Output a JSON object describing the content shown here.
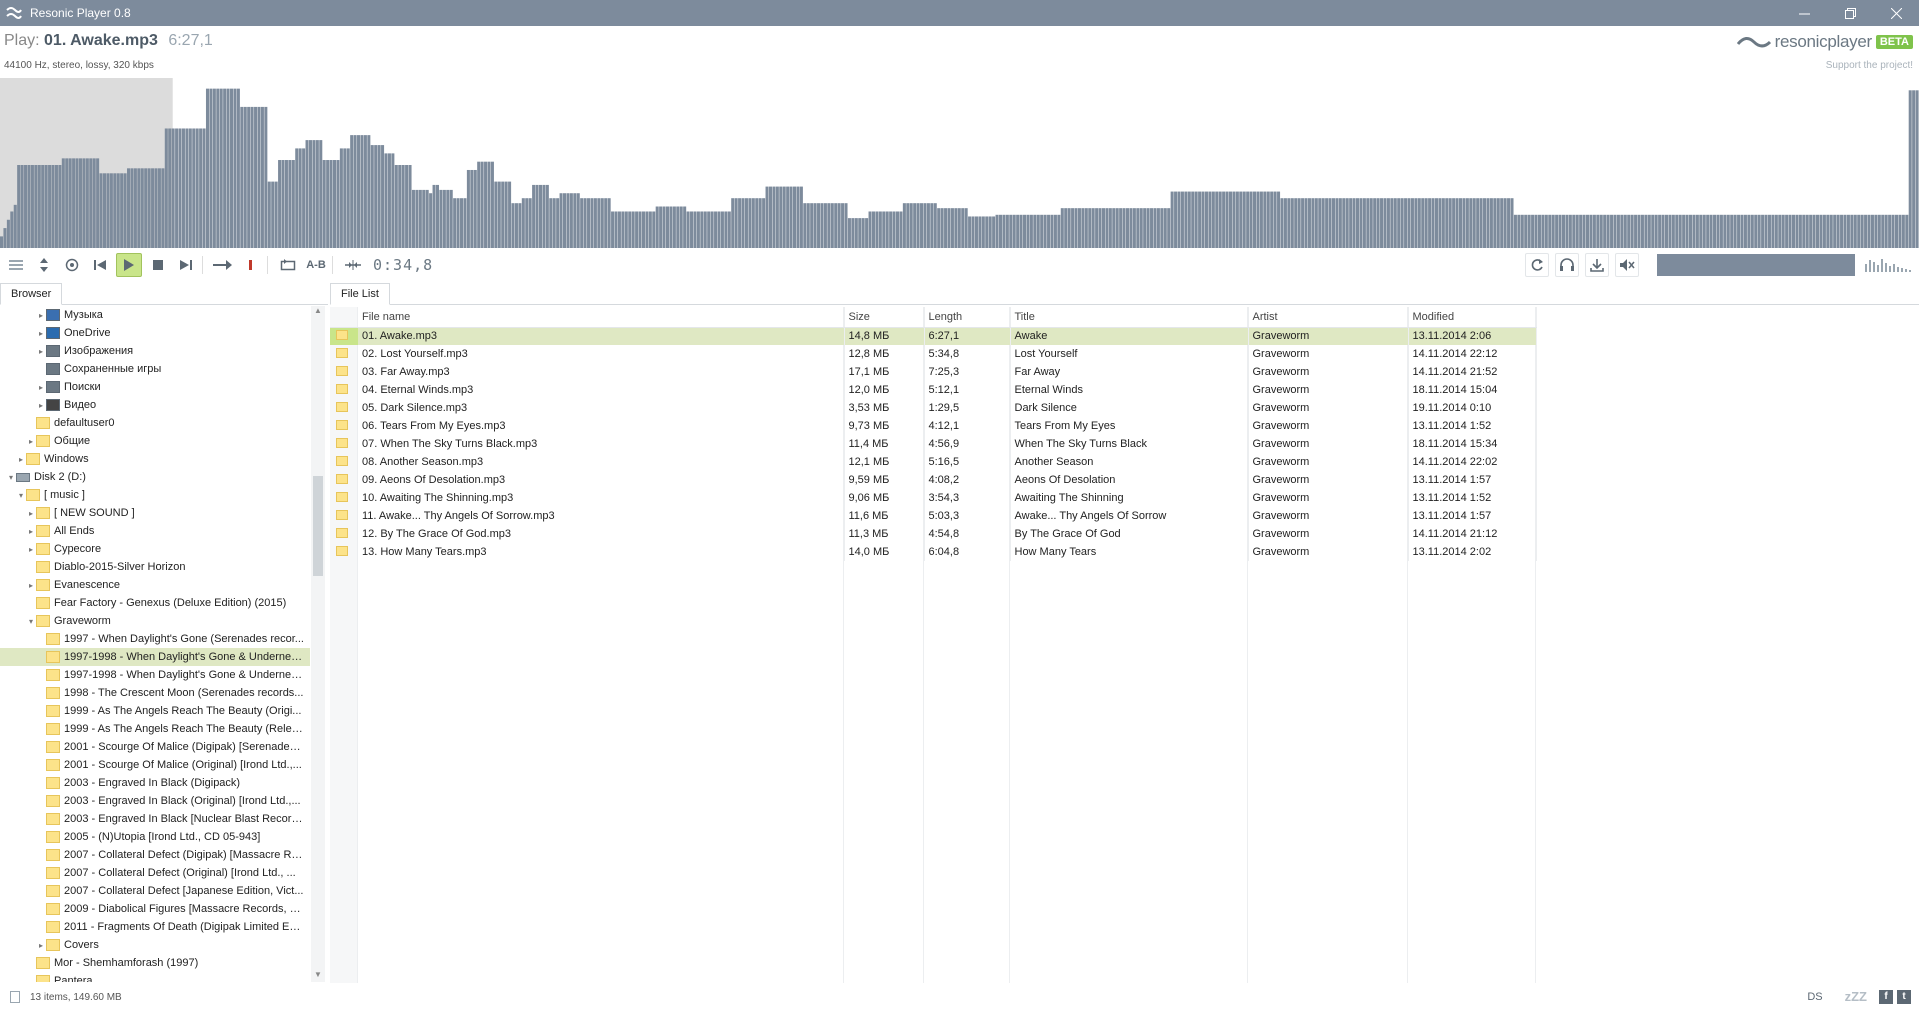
{
  "window": {
    "title": "Resonic Player 0.8",
    "controls": [
      "minimize",
      "restore",
      "close"
    ]
  },
  "nowplaying": {
    "prefix": "Play:",
    "track": "01. Awake.mp3",
    "duration": "6:27,1",
    "format": "44100 Hz, stereo, lossy, 320 kbps"
  },
  "brand": {
    "name": "resonicplayer",
    "badge": "BETA",
    "support": "Support the project!"
  },
  "colors": {
    "accent": "#c9e58a",
    "selection": "#dfe8c3",
    "chrome": "#7d8b9c",
    "folder": "#fce38a"
  },
  "waveform": {
    "played_fraction": 0.09,
    "levels": [
      0.07,
      0.12,
      0.17,
      0.22,
      0.26,
      0.5,
      0.5,
      0.5,
      0.5,
      0.5,
      0.5,
      0.5,
      0.5,
      0.5,
      0.5,
      0.5,
      0.5,
      0.5,
      0.54,
      0.54,
      0.54,
      0.54,
      0.54,
      0.54,
      0.54,
      0.54,
      0.54,
      0.54,
      0.54,
      0.45,
      0.45,
      0.45,
      0.45,
      0.45,
      0.45,
      0.45,
      0.45,
      0.48,
      0.48,
      0.48,
      0.48,
      0.48,
      0.48,
      0.48,
      0.48,
      0.48,
      0.48,
      0.48,
      0.72,
      0.72,
      0.72,
      0.72,
      0.72,
      0.72,
      0.72,
      0.72,
      0.72,
      0.72,
      0.72,
      0.72,
      0.96,
      0.96,
      0.96,
      0.96,
      0.96,
      0.96,
      0.96,
      0.96,
      0.96,
      0.96,
      0.85,
      0.85,
      0.85,
      0.85,
      0.85,
      0.85,
      0.85,
      0.85,
      0.4,
      0.4,
      0.4,
      0.53,
      0.53,
      0.53,
      0.53,
      0.53,
      0.6,
      0.6,
      0.6,
      0.65,
      0.65,
      0.65,
      0.65,
      0.65,
      0.53,
      0.53,
      0.53,
      0.53,
      0.53,
      0.6,
      0.6,
      0.6,
      0.68,
      0.68,
      0.68,
      0.68,
      0.68,
      0.68,
      0.62,
      0.62,
      0.62,
      0.62,
      0.57,
      0.57,
      0.57,
      0.5,
      0.5,
      0.5,
      0.5,
      0.5,
      0.35,
      0.35,
      0.35,
      0.35,
      0.35,
      0.33,
      0.38,
      0.38,
      0.35,
      0.35,
      0.35,
      0.35,
      0.3,
      0.3,
      0.3,
      0.3,
      0.47,
      0.47,
      0.47,
      0.52,
      0.52,
      0.52,
      0.52,
      0.52,
      0.4,
      0.4,
      0.4,
      0.4,
      0.4,
      0.27,
      0.27,
      0.27,
      0.3,
      0.3,
      0.3,
      0.38,
      0.38,
      0.38,
      0.38,
      0.38,
      0.3,
      0.3,
      0.3,
      0.33,
      0.33,
      0.33,
      0.33,
      0.33,
      0.33,
      0.3,
      0.3,
      0.3,
      0.3,
      0.3,
      0.3,
      0.3,
      0.3,
      0.3,
      0.22,
      0.22,
      0.22,
      0.22,
      0.22,
      0.22,
      0.22,
      0.22,
      0.22,
      0.22,
      0.22,
      0.22,
      0.22,
      0.25,
      0.25,
      0.25,
      0.25,
      0.25,
      0.25,
      0.25,
      0.25,
      0.25,
      0.22,
      0.22,
      0.22,
      0.22,
      0.22,
      0.22,
      0.22,
      0.22,
      0.22,
      0.22,
      0.22,
      0.22,
      0.22,
      0.3,
      0.3,
      0.3,
      0.3,
      0.3,
      0.3,
      0.3,
      0.3,
      0.3,
      0.3,
      0.37,
      0.37,
      0.37,
      0.37,
      0.37,
      0.37,
      0.37,
      0.37,
      0.37,
      0.37,
      0.37,
      0.27,
      0.27,
      0.27,
      0.27,
      0.27,
      0.27,
      0.27,
      0.27,
      0.27,
      0.27,
      0.27,
      0.27,
      0.27,
      0.18,
      0.18,
      0.18,
      0.18,
      0.18,
      0.18,
      0.22,
      0.22,
      0.22,
      0.22,
      0.22,
      0.22,
      0.22,
      0.22,
      0.22,
      0.22,
      0.27,
      0.27,
      0.27,
      0.27,
      0.27,
      0.27,
      0.27,
      0.27,
      0.27,
      0.27,
      0.24,
      0.24,
      0.24,
      0.24,
      0.24,
      0.24,
      0.24,
      0.24,
      0.24,
      0.19,
      0.19,
      0.19,
      0.19,
      0.19,
      0.19,
      0.19,
      0.19,
      0.2,
      0.2,
      0.2,
      0.2,
      0.2,
      0.2,
      0.2,
      0.2,
      0.2,
      0.2,
      0.2,
      0.2,
      0.2,
      0.2,
      0.2,
      0.2,
      0.2,
      0.2,
      0.2,
      0.24,
      0.24,
      0.24,
      0.24,
      0.24,
      0.24,
      0.24,
      0.24,
      0.24,
      0.24,
      0.24,
      0.24,
      0.24,
      0.24,
      0.24,
      0.24,
      0.24,
      0.24,
      0.24,
      0.24,
      0.24,
      0.24,
      0.24,
      0.24,
      0.24,
      0.24,
      0.24,
      0.24,
      0.24,
      0.24,
      0.24,
      0.24,
      0.34,
      0.34,
      0.34,
      0.34,
      0.34,
      0.34,
      0.34,
      0.34,
      0.34,
      0.34,
      0.34,
      0.34,
      0.34,
      0.34,
      0.34,
      0.34,
      0.34,
      0.34,
      0.34,
      0.34,
      0.34,
      0.34,
      0.34,
      0.34,
      0.34,
      0.34,
      0.34,
      0.34,
      0.34,
      0.34,
      0.34,
      0.34,
      0.3,
      0.3,
      0.3,
      0.3,
      0.3,
      0.3,
      0.3,
      0.3,
      0.3,
      0.3,
      0.3,
      0.3,
      0.3,
      0.3,
      0.3,
      0.3,
      0.3,
      0.3,
      0.3,
      0.3,
      0.3,
      0.3,
      0.3,
      0.3,
      0.3,
      0.3,
      0.3,
      0.3,
      0.3,
      0.3,
      0.3,
      0.3,
      0.3,
      0.3,
      0.3,
      0.3,
      0.3,
      0.3,
      0.3,
      0.3,
      0.3,
      0.3,
      0.3,
      0.3,
      0.3,
      0.3,
      0.3,
      0.3,
      0.3,
      0.3,
      0.3,
      0.3,
      0.3,
      0.3,
      0.3,
      0.3,
      0.3,
      0.3,
      0.3,
      0.3,
      0.3,
      0.3,
      0.3,
      0.3,
      0.3,
      0.3,
      0.3,
      0.3,
      0.2,
      0.2,
      0.2,
      0.2,
      0.2,
      0.2,
      0.2,
      0.2,
      0.2,
      0.2,
      0.2,
      0.2,
      0.2,
      0.2,
      0.2,
      0.2,
      0.2,
      0.2,
      0.2,
      0.2,
      0.2,
      0.2,
      0.2,
      0.2,
      0.2,
      0.2,
      0.2,
      0.2,
      0.2,
      0.2,
      0.2,
      0.2,
      0.2,
      0.2,
      0.2,
      0.2,
      0.2,
      0.2,
      0.2,
      0.2,
      0.2,
      0.2,
      0.2,
      0.2,
      0.2,
      0.2,
      0.2,
      0.2,
      0.2,
      0.2,
      0.2,
      0.2,
      0.2,
      0.2,
      0.2,
      0.2,
      0.2,
      0.2,
      0.2,
      0.2,
      0.2,
      0.2,
      0.2,
      0.2,
      0.2,
      0.2,
      0.2,
      0.2,
      0.2,
      0.2,
      0.2,
      0.2,
      0.2,
      0.2,
      0.2,
      0.2,
      0.2,
      0.2,
      0.2,
      0.2,
      0.2,
      0.2,
      0.2,
      0.2,
      0.2,
      0.2,
      0.2,
      0.2,
      0.2,
      0.2,
      0.2,
      0.2,
      0.2,
      0.2,
      0.2,
      0.2,
      0.2,
      0.2,
      0.2,
      0.2,
      0.2,
      0.2,
      0.2,
      0.2,
      0.2,
      0.2,
      0.2,
      0.2,
      0.2,
      0.2,
      0.2,
      0.2,
      0.2,
      0.2,
      0.2,
      0.95,
      0.95,
      0.95
    ]
  },
  "toolbar": {
    "position": "0:34,8",
    "left_buttons": [
      "list-icon",
      "updown-icon",
      "target-icon",
      "prev-icon",
      "play-icon",
      "stop-icon",
      "next-icon",
      "forward-icon",
      "record-icon",
      "loop-icon",
      "ab-icon",
      "split-icon"
    ],
    "ab_label": "A-B",
    "right_buttons": [
      "refresh-icon",
      "headphones-icon",
      "download-icon",
      "mute-icon"
    ]
  },
  "browser": {
    "tab": "Browser",
    "items": [
      {
        "label": "Музыка",
        "depth": 3,
        "exp": "▸",
        "icon": "music"
      },
      {
        "label": "OneDrive",
        "depth": 3,
        "exp": "▸",
        "icon": "cloud"
      },
      {
        "label": "Изображения",
        "depth": 3,
        "exp": "▸",
        "icon": "pictures"
      },
      {
        "label": "Сохраненные игры",
        "depth": 3,
        "exp": "",
        "icon": "games"
      },
      {
        "label": "Поиски",
        "depth": 3,
        "exp": "▸",
        "icon": "search"
      },
      {
        "label": "Видео",
        "depth": 3,
        "exp": "▸",
        "icon": "video"
      },
      {
        "label": "defaultuser0",
        "depth": 2,
        "exp": "",
        "icon": "folder"
      },
      {
        "label": "Общие",
        "depth": 2,
        "exp": "▸",
        "icon": "folder"
      },
      {
        "label": "Windows",
        "depth": 1,
        "exp": "▸",
        "icon": "folder"
      },
      {
        "label": "Disk 2 (D:)",
        "depth": 0,
        "exp": "▾",
        "icon": "drive"
      },
      {
        "label": "[ music ]",
        "depth": 1,
        "exp": "▾",
        "icon": "folder"
      },
      {
        "label": "[ NEW SOUND ]",
        "depth": 2,
        "exp": "▸",
        "icon": "folder"
      },
      {
        "label": "All Ends",
        "depth": 2,
        "exp": "▸",
        "icon": "folder"
      },
      {
        "label": "Cypecore",
        "depth": 2,
        "exp": "▸",
        "icon": "folder"
      },
      {
        "label": "Diablo-2015-Silver Horizon",
        "depth": 2,
        "exp": "",
        "icon": "folder"
      },
      {
        "label": "Evanescence",
        "depth": 2,
        "exp": "▸",
        "icon": "folder"
      },
      {
        "label": "Fear Factory - Genexus (Deluxe Edition) (2015)",
        "depth": 2,
        "exp": "",
        "icon": "folder"
      },
      {
        "label": "Graveworm",
        "depth": 2,
        "exp": "▾",
        "icon": "folder"
      },
      {
        "label": "1997 - When Daylight's Gone (Serenades recor...",
        "depth": 3,
        "exp": "",
        "icon": "folder"
      },
      {
        "label": "1997-1998 - When Daylight's Gone & Undernea...",
        "depth": 3,
        "exp": "",
        "icon": "folder",
        "selected": true
      },
      {
        "label": "1997-1998 - When Daylight's Gone & Underne a...",
        "depth": 3,
        "exp": "",
        "icon": "folder"
      },
      {
        "label": "1998 - The Crescent Moon (Serenades records...",
        "depth": 3,
        "exp": "",
        "icon": "folder"
      },
      {
        "label": "1999 - As The Angels Reach The Beauty (Origi...",
        "depth": 3,
        "exp": "",
        "icon": "folder"
      },
      {
        "label": "1999 - As The Angels Reach The Beauty (Relea...",
        "depth": 3,
        "exp": "",
        "icon": "folder"
      },
      {
        "label": "2001 - Scourge Of Malice (Digipak) [Serenades ...",
        "depth": 3,
        "exp": "",
        "icon": "folder"
      },
      {
        "label": "2001 - Scourge Of Malice (Original) [Irond Ltd.,...",
        "depth": 3,
        "exp": "",
        "icon": "folder"
      },
      {
        "label": "2003 - Engraved In Black (Digipack)",
        "depth": 3,
        "exp": "",
        "icon": "folder"
      },
      {
        "label": "2003 - Engraved In Black (Original) [Irond Ltd.,...",
        "depth": 3,
        "exp": "",
        "icon": "folder"
      },
      {
        "label": "2003 - Engraved In Black [Nuclear Blast Record...",
        "depth": 3,
        "exp": "",
        "icon": "folder"
      },
      {
        "label": "2005 - (N)Utopia [Irond Ltd., CD 05-943]",
        "depth": 3,
        "exp": "",
        "icon": "folder"
      },
      {
        "label": "2007 - Collateral Defect (Digipak) [Massacre Re...",
        "depth": 3,
        "exp": "",
        "icon": "folder"
      },
      {
        "label": "2007 - Collateral Defect (Original) [Irond Ltd., ...",
        "depth": 3,
        "exp": "",
        "icon": "folder"
      },
      {
        "label": "2007 - Collateral Defect [Japanese Edition, Vict...",
        "depth": 3,
        "exp": "",
        "icon": "folder"
      },
      {
        "label": "2009 - Diabolical Figures [Massacre Records, M...",
        "depth": 3,
        "exp": "",
        "icon": "folder"
      },
      {
        "label": "2011 - Fragments Of Death (Digipak Limited Edi...",
        "depth": 3,
        "exp": "",
        "icon": "folder"
      },
      {
        "label": "Covers",
        "depth": 3,
        "exp": "▸",
        "icon": "folder"
      },
      {
        "label": "Mor - Shemhamforash (1997)",
        "depth": 2,
        "exp": "",
        "icon": "folder"
      },
      {
        "label": "Pantera",
        "depth": 2,
        "exp": "",
        "icon": "folder"
      }
    ]
  },
  "filelist": {
    "tab": "File List",
    "columns": [
      "File name",
      "Size",
      "Length",
      "Title",
      "Artist",
      "Modified"
    ],
    "rows": [
      [
        "01. Awake.mp3",
        "14,8 МБ",
        "6:27,1",
        "Awake",
        "Graveworm",
        "13.11.2014 2:06"
      ],
      [
        "02. Lost Yourself.mp3",
        "12,8 МБ",
        "5:34,8",
        "Lost Yourself",
        "Graveworm",
        "14.11.2014 22:12"
      ],
      [
        "03. Far Away.mp3",
        "17,1 МБ",
        "7:25,3",
        "Far Away",
        "Graveworm",
        "14.11.2014 21:52"
      ],
      [
        "04. Eternal Winds.mp3",
        "12,0 МБ",
        "5:12,1",
        "Eternal Winds",
        "Graveworm",
        "18.11.2014 15:04"
      ],
      [
        "05. Dark Silence.mp3",
        "3,53 МБ",
        "1:29,5",
        "Dark Silence",
        "Graveworm",
        "19.11.2014 0:10"
      ],
      [
        "06. Tears From My Eyes.mp3",
        "9,73 МБ",
        "4:12,1",
        "Tears From My Eyes",
        "Graveworm",
        "13.11.2014 1:52"
      ],
      [
        "07. When The Sky Turns Black.mp3",
        "11,4 МБ",
        "4:56,9",
        "When The Sky Turns Black",
        "Graveworm",
        "18.11.2014 15:34"
      ],
      [
        "08. Another Season.mp3",
        "12,1 МБ",
        "5:16,5",
        "Another Season",
        "Graveworm",
        "14.11.2014 22:02"
      ],
      [
        "09. Aeons Of Desolation.mp3",
        "9,59 МБ",
        "4:08,2",
        "Aeons Of Desolation",
        "Graveworm",
        "13.11.2014 1:57"
      ],
      [
        "10. Awaiting The Shinning.mp3",
        "9,06 МБ",
        "3:54,3",
        "Awaiting The Shinning",
        "Graveworm",
        "13.11.2014 1:52"
      ],
      [
        "11. Awake... Thy Angels Of Sorrow.mp3",
        "11,6 МБ",
        "5:03,3",
        "Awake... Thy Angels Of Sorrow",
        "Graveworm",
        "13.11.2014 1:57"
      ],
      [
        "12. By The Grace Of God.mp3",
        "11,3 МБ",
        "4:54,8",
        "By The Grace Of God",
        "Graveworm",
        "14.11.2014 21:12"
      ],
      [
        "13. How Many Tears.mp3",
        "14,0 МБ",
        "6:04,8",
        "How Many Tears",
        "Graveworm",
        "13.11.2014 2:02"
      ]
    ],
    "playing_row": 0
  },
  "status": {
    "summary": "13 items, 149.60 MB",
    "ds": "DS",
    "sleep": "zZZ",
    "social": [
      "facebook-icon",
      "twitter-icon"
    ]
  }
}
